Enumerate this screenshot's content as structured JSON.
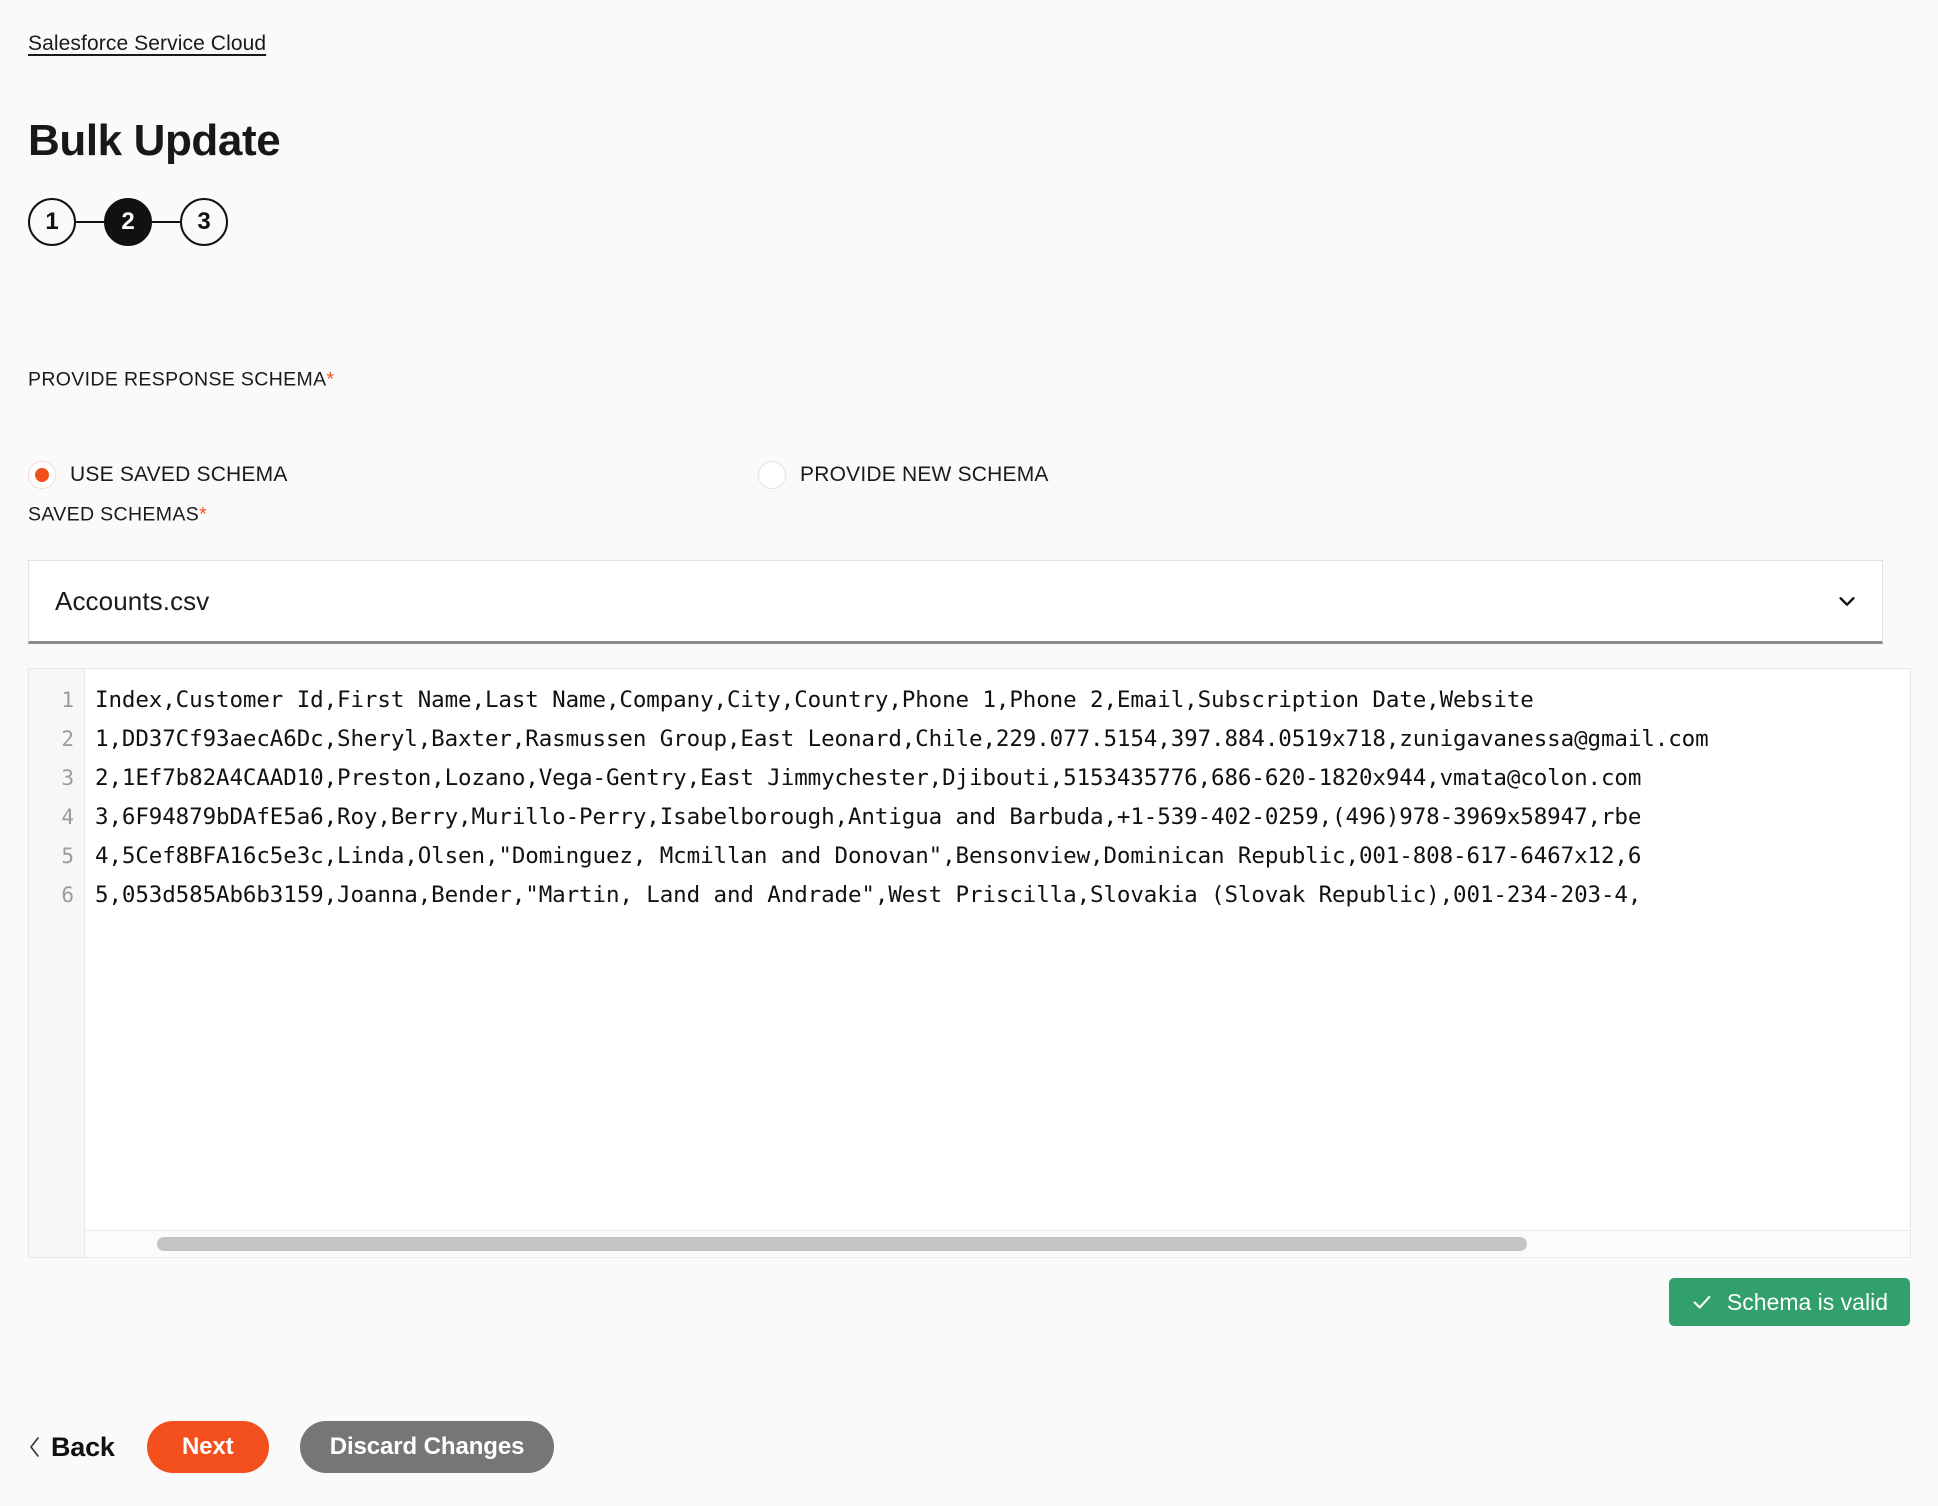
{
  "breadcrumb": {
    "label": "Salesforce Service Cloud"
  },
  "header": {
    "title": "Bulk Update"
  },
  "stepper": {
    "steps": [
      {
        "label": "1",
        "active": false
      },
      {
        "label": "2",
        "active": true
      },
      {
        "label": "3",
        "active": false
      }
    ]
  },
  "form": {
    "response_schema": {
      "label": "PROVIDE RESPONSE SCHEMA",
      "required_marker": "*",
      "options": [
        {
          "label": "USE SAVED SCHEMA",
          "selected": true
        },
        {
          "label": "PROVIDE NEW SCHEMA",
          "selected": false
        }
      ]
    },
    "saved_schemas": {
      "label": "SAVED SCHEMAS",
      "required_marker": "*",
      "selected_value": "Accounts.csv",
      "chevron_icon": "chevron-down-icon"
    }
  },
  "editor": {
    "line_numbers": [
      "1",
      "2",
      "3",
      "4",
      "5",
      "6"
    ],
    "lines": [
      "Index,Customer Id,First Name,Last Name,Company,City,Country,Phone 1,Phone 2,Email,Subscription Date,Website",
      "1,DD37Cf93aecA6Dc,Sheryl,Baxter,Rasmussen Group,East Leonard,Chile,229.077.5154,397.884.0519x718,zunigavanessa@gmail.com",
      "2,1Ef7b82A4CAAD10,Preston,Lozano,Vega-Gentry,East Jimmychester,Djibouti,5153435776,686-620-1820x944,vmata@colon.com",
      "3,6F94879bDAfE5a6,Roy,Berry,Murillo-Perry,Isabelborough,Antigua and Barbuda,+1-539-402-0259,(496)978-3969x58947,rbe",
      "4,5Cef8BFA16c5e3c,Linda,Olsen,\"Dominguez, Mcmillan and Donovan\",Bensonview,Dominican Republic,001-808-617-6467x12,6",
      "5,053d585Ab6b3159,Joanna,Bender,\"Martin, Land and Andrade\",West Priscilla,Slovakia (Slovak Republic),001-234-203-4,"
    ]
  },
  "status": {
    "valid_badge_label": "Schema is valid",
    "valid_badge_icon": "check-icon",
    "valid_badge_color": "#31a06a"
  },
  "footer": {
    "back_label": "Back",
    "back_icon": "chevron-left-icon",
    "next_label": "Next",
    "discard_label": "Discard Changes",
    "next_color": "#f4501e",
    "discard_color": "#767676"
  }
}
